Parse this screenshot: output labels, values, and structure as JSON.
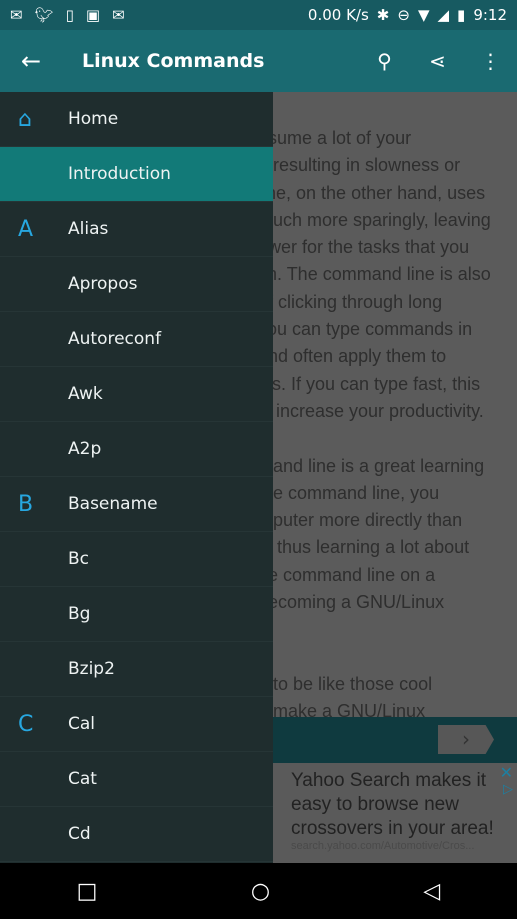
{
  "status": {
    "net_speed": "0.00 K/s",
    "time": "9:12"
  },
  "appbar": {
    "title": "Linux Commands"
  },
  "content": {
    "lines": [
      "nsume a lot of your",
      "n resulting in slowness or",
      "line, on the other hand, uses",
      "much more sparingly, leaving",
      "ower for the tasks that you",
      "sh. The command line is also",
      "of clicking through long",
      "you can type commands in",
      "and often apply them to",
      "cts. If you can type fast, this",
      "ly increase your productivity.",
      "",
      "mand line is a great learning",
      "the command line, you",
      "mputer more directly than",
      "s, thus learning a lot about",
      "ne command line on a",
      "becoming a GNU/Linux",
      "",
      "",
      "d to be like those cool",
      "n make a GNU/Linux"
    ]
  },
  "ad": {
    "text": "Yahoo Search makes it easy to browse new crossovers in your area!",
    "url": "search.yahoo.com/Automotive/Cros..."
  },
  "drawer": {
    "items": [
      {
        "label": "Home",
        "icon": "home"
      },
      {
        "label": "Introduction",
        "active": true
      },
      {
        "label": "Alias",
        "letter": "A"
      },
      {
        "label": "Apropos"
      },
      {
        "label": "Autoreconf"
      },
      {
        "label": "Awk"
      },
      {
        "label": "A2p"
      },
      {
        "label": "Basename",
        "letter": "B"
      },
      {
        "label": "Bc"
      },
      {
        "label": "Bg"
      },
      {
        "label": "Bzip2"
      },
      {
        "label": "Cal",
        "letter": "C"
      },
      {
        "label": "Cat"
      },
      {
        "label": "Cd"
      }
    ]
  },
  "colors": {
    "toolbar": "#1a6a71",
    "drawer": "#1f2d2e",
    "active": "#127a78",
    "letter": "#27a7e0"
  }
}
